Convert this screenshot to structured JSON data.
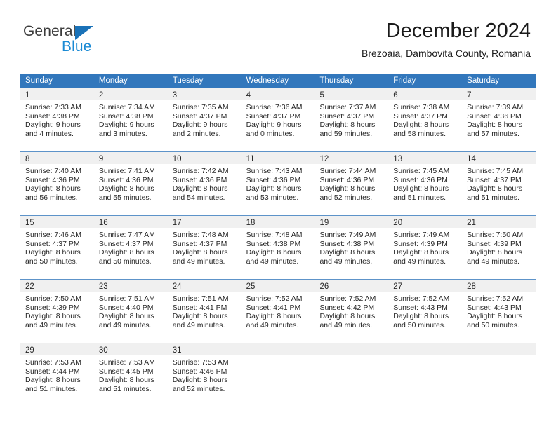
{
  "brand": {
    "name_part1": "General",
    "name_part2": "Blue",
    "triangle_color": "#1a72b8",
    "blue_color": "#1a8ad4"
  },
  "header": {
    "title": "December 2024",
    "subtitle": "Brezoaia, Dambovita County, Romania"
  },
  "theme": {
    "header_bg": "#3277bc",
    "header_text": "#ffffff",
    "daynum_band": "#f0f0f0",
    "row_divider": "#5d93c9"
  },
  "weekdays": [
    "Sunday",
    "Monday",
    "Tuesday",
    "Wednesday",
    "Thursday",
    "Friday",
    "Saturday"
  ],
  "weeks": [
    [
      {
        "day": "1",
        "sunrise": "Sunrise: 7:33 AM",
        "sunset": "Sunset: 4:38 PM",
        "daylight1": "Daylight: 9 hours",
        "daylight2": "and 4 minutes."
      },
      {
        "day": "2",
        "sunrise": "Sunrise: 7:34 AM",
        "sunset": "Sunset: 4:38 PM",
        "daylight1": "Daylight: 9 hours",
        "daylight2": "and 3 minutes."
      },
      {
        "day": "3",
        "sunrise": "Sunrise: 7:35 AM",
        "sunset": "Sunset: 4:37 PM",
        "daylight1": "Daylight: 9 hours",
        "daylight2": "and 2 minutes."
      },
      {
        "day": "4",
        "sunrise": "Sunrise: 7:36 AM",
        "sunset": "Sunset: 4:37 PM",
        "daylight1": "Daylight: 9 hours",
        "daylight2": "and 0 minutes."
      },
      {
        "day": "5",
        "sunrise": "Sunrise: 7:37 AM",
        "sunset": "Sunset: 4:37 PM",
        "daylight1": "Daylight: 8 hours",
        "daylight2": "and 59 minutes."
      },
      {
        "day": "6",
        "sunrise": "Sunrise: 7:38 AM",
        "sunset": "Sunset: 4:37 PM",
        "daylight1": "Daylight: 8 hours",
        "daylight2": "and 58 minutes."
      },
      {
        "day": "7",
        "sunrise": "Sunrise: 7:39 AM",
        "sunset": "Sunset: 4:36 PM",
        "daylight1": "Daylight: 8 hours",
        "daylight2": "and 57 minutes."
      }
    ],
    [
      {
        "day": "8",
        "sunrise": "Sunrise: 7:40 AM",
        "sunset": "Sunset: 4:36 PM",
        "daylight1": "Daylight: 8 hours",
        "daylight2": "and 56 minutes."
      },
      {
        "day": "9",
        "sunrise": "Sunrise: 7:41 AM",
        "sunset": "Sunset: 4:36 PM",
        "daylight1": "Daylight: 8 hours",
        "daylight2": "and 55 minutes."
      },
      {
        "day": "10",
        "sunrise": "Sunrise: 7:42 AM",
        "sunset": "Sunset: 4:36 PM",
        "daylight1": "Daylight: 8 hours",
        "daylight2": "and 54 minutes."
      },
      {
        "day": "11",
        "sunrise": "Sunrise: 7:43 AM",
        "sunset": "Sunset: 4:36 PM",
        "daylight1": "Daylight: 8 hours",
        "daylight2": "and 53 minutes."
      },
      {
        "day": "12",
        "sunrise": "Sunrise: 7:44 AM",
        "sunset": "Sunset: 4:36 PM",
        "daylight1": "Daylight: 8 hours",
        "daylight2": "and 52 minutes."
      },
      {
        "day": "13",
        "sunrise": "Sunrise: 7:45 AM",
        "sunset": "Sunset: 4:36 PM",
        "daylight1": "Daylight: 8 hours",
        "daylight2": "and 51 minutes."
      },
      {
        "day": "14",
        "sunrise": "Sunrise: 7:45 AM",
        "sunset": "Sunset: 4:37 PM",
        "daylight1": "Daylight: 8 hours",
        "daylight2": "and 51 minutes."
      }
    ],
    [
      {
        "day": "15",
        "sunrise": "Sunrise: 7:46 AM",
        "sunset": "Sunset: 4:37 PM",
        "daylight1": "Daylight: 8 hours",
        "daylight2": "and 50 minutes."
      },
      {
        "day": "16",
        "sunrise": "Sunrise: 7:47 AM",
        "sunset": "Sunset: 4:37 PM",
        "daylight1": "Daylight: 8 hours",
        "daylight2": "and 50 minutes."
      },
      {
        "day": "17",
        "sunrise": "Sunrise: 7:48 AM",
        "sunset": "Sunset: 4:37 PM",
        "daylight1": "Daylight: 8 hours",
        "daylight2": "and 49 minutes."
      },
      {
        "day": "18",
        "sunrise": "Sunrise: 7:48 AM",
        "sunset": "Sunset: 4:38 PM",
        "daylight1": "Daylight: 8 hours",
        "daylight2": "and 49 minutes."
      },
      {
        "day": "19",
        "sunrise": "Sunrise: 7:49 AM",
        "sunset": "Sunset: 4:38 PM",
        "daylight1": "Daylight: 8 hours",
        "daylight2": "and 49 minutes."
      },
      {
        "day": "20",
        "sunrise": "Sunrise: 7:49 AM",
        "sunset": "Sunset: 4:39 PM",
        "daylight1": "Daylight: 8 hours",
        "daylight2": "and 49 minutes."
      },
      {
        "day": "21",
        "sunrise": "Sunrise: 7:50 AM",
        "sunset": "Sunset: 4:39 PM",
        "daylight1": "Daylight: 8 hours",
        "daylight2": "and 49 minutes."
      }
    ],
    [
      {
        "day": "22",
        "sunrise": "Sunrise: 7:50 AM",
        "sunset": "Sunset: 4:39 PM",
        "daylight1": "Daylight: 8 hours",
        "daylight2": "and 49 minutes."
      },
      {
        "day": "23",
        "sunrise": "Sunrise: 7:51 AM",
        "sunset": "Sunset: 4:40 PM",
        "daylight1": "Daylight: 8 hours",
        "daylight2": "and 49 minutes."
      },
      {
        "day": "24",
        "sunrise": "Sunrise: 7:51 AM",
        "sunset": "Sunset: 4:41 PM",
        "daylight1": "Daylight: 8 hours",
        "daylight2": "and 49 minutes."
      },
      {
        "day": "25",
        "sunrise": "Sunrise: 7:52 AM",
        "sunset": "Sunset: 4:41 PM",
        "daylight1": "Daylight: 8 hours",
        "daylight2": "and 49 minutes."
      },
      {
        "day": "26",
        "sunrise": "Sunrise: 7:52 AM",
        "sunset": "Sunset: 4:42 PM",
        "daylight1": "Daylight: 8 hours",
        "daylight2": "and 49 minutes."
      },
      {
        "day": "27",
        "sunrise": "Sunrise: 7:52 AM",
        "sunset": "Sunset: 4:43 PM",
        "daylight1": "Daylight: 8 hours",
        "daylight2": "and 50 minutes."
      },
      {
        "day": "28",
        "sunrise": "Sunrise: 7:52 AM",
        "sunset": "Sunset: 4:43 PM",
        "daylight1": "Daylight: 8 hours",
        "daylight2": "and 50 minutes."
      }
    ],
    [
      {
        "day": "29",
        "sunrise": "Sunrise: 7:53 AM",
        "sunset": "Sunset: 4:44 PM",
        "daylight1": "Daylight: 8 hours",
        "daylight2": "and 51 minutes."
      },
      {
        "day": "30",
        "sunrise": "Sunrise: 7:53 AM",
        "sunset": "Sunset: 4:45 PM",
        "daylight1": "Daylight: 8 hours",
        "daylight2": "and 51 minutes."
      },
      {
        "day": "31",
        "sunrise": "Sunrise: 7:53 AM",
        "sunset": "Sunset: 4:46 PM",
        "daylight1": "Daylight: 8 hours",
        "daylight2": "and 52 minutes."
      },
      {
        "day": "",
        "sunrise": "",
        "sunset": "",
        "daylight1": "",
        "daylight2": ""
      },
      {
        "day": "",
        "sunrise": "",
        "sunset": "",
        "daylight1": "",
        "daylight2": ""
      },
      {
        "day": "",
        "sunrise": "",
        "sunset": "",
        "daylight1": "",
        "daylight2": ""
      },
      {
        "day": "",
        "sunrise": "",
        "sunset": "",
        "daylight1": "",
        "daylight2": ""
      }
    ]
  ]
}
